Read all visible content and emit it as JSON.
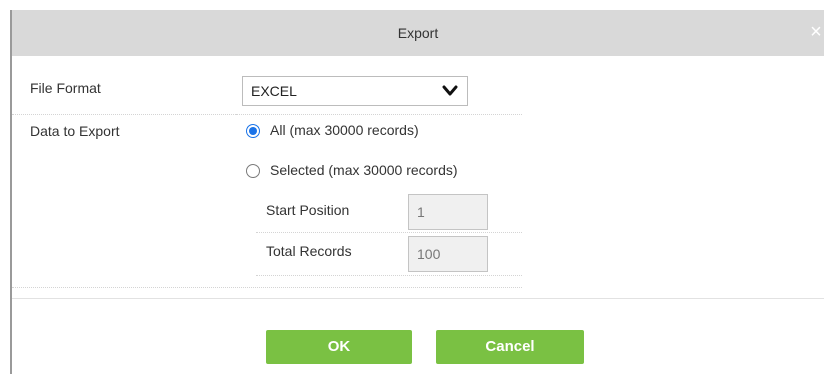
{
  "dialog": {
    "title": "Export",
    "close_glyph": "×",
    "icons": {
      "close": "close-icon",
      "dropdown": "chevron-down-icon"
    },
    "colors": {
      "titlebar": "#d9d9d9",
      "button": "#7ac143",
      "radio_accent": "#1a73e8"
    }
  },
  "form": {
    "file_format": {
      "label": "File Format",
      "value": "EXCEL"
    },
    "data_to_export": {
      "label": "Data to Export",
      "options": [
        {
          "label": "All (max 30000 records)",
          "checked": true
        },
        {
          "label": "Selected (max 30000 records)",
          "checked": false
        }
      ]
    },
    "start_position": {
      "label": "Start Position",
      "value": "1"
    },
    "total_records": {
      "label": "Total Records",
      "value": "100"
    }
  },
  "buttons": {
    "ok": "OK",
    "cancel": "Cancel"
  }
}
